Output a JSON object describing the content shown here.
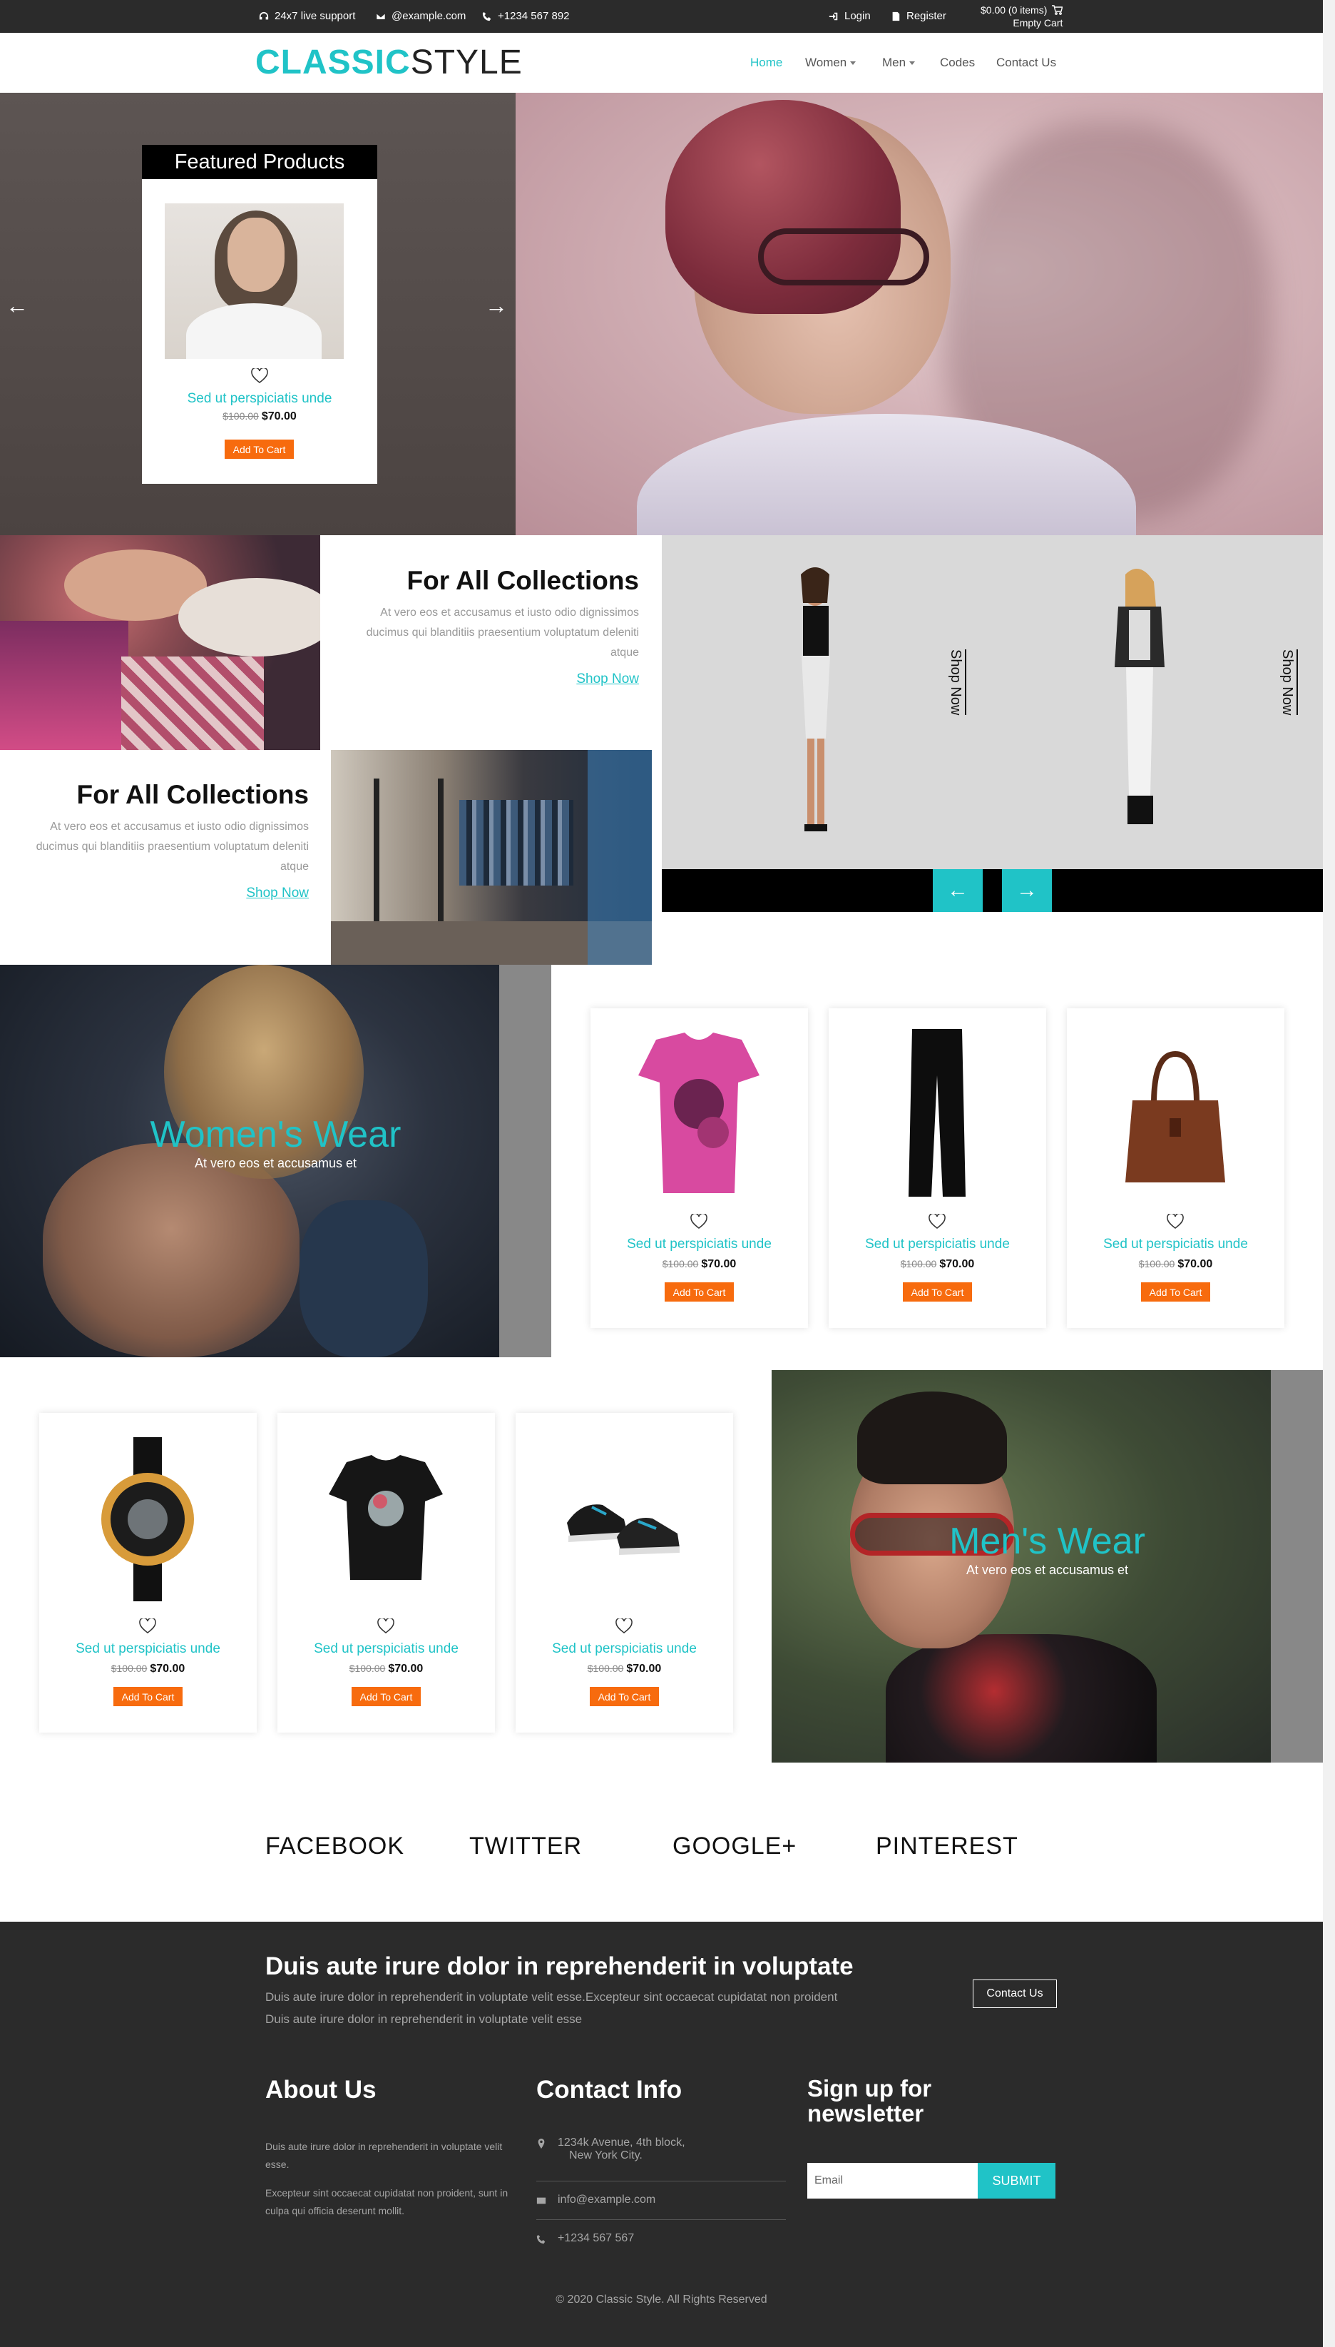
{
  "topbar": {
    "support": "24x7 live support",
    "email": "@example.com",
    "phone": "+1234 567 892",
    "login": "Login",
    "register": "Register",
    "cart_total": "$0.00 (0 items)",
    "cart_status": "Empty Cart"
  },
  "logo": {
    "part1": "CLASSIC",
    "part2": "STYLE"
  },
  "nav": {
    "home": "Home",
    "women": "Women",
    "men": "Men",
    "codes": "Codes",
    "contact": "Contact Us"
  },
  "featured": {
    "title": "Featured Products",
    "product": {
      "name": "Sed ut perspiciatis unde",
      "old_price": "$100.00",
      "price": "$70.00",
      "button": "Add To Cart"
    }
  },
  "collections": [
    {
      "title": "For All Collections",
      "text": "At vero eos et accusamus et iusto odio dignissimos ducimus qui blanditiis praesentium voluptatum deleniti atque",
      "link": "Shop Now"
    },
    {
      "title": "For All Collections",
      "text": "At vero eos et accusamus et iusto odio dignissimos ducimus qui blanditiis praesentium voluptatum deleniti atque",
      "link": "Shop Now"
    }
  ],
  "models": {
    "shop_now_1": "Shop Now",
    "shop_now_2": "Shop Now"
  },
  "women": {
    "title": "Women's Wear",
    "subtitle": "At vero eos et accusamus et"
  },
  "men": {
    "title": "Men's Wear",
    "subtitle": "At vero eos et accusamus et"
  },
  "products_women": [
    {
      "name": "Sed ut perspiciatis unde",
      "old_price": "$100.00",
      "price": "$70.00",
      "button": "Add To Cart",
      "icon": "tshirt-pink"
    },
    {
      "name": "Sed ut perspiciatis unde",
      "old_price": "$100.00",
      "price": "$70.00",
      "button": "Add To Cart",
      "icon": "pants-black"
    },
    {
      "name": "Sed ut perspiciatis unde",
      "old_price": "$100.00",
      "price": "$70.00",
      "button": "Add To Cart",
      "icon": "handbag-brown"
    }
  ],
  "products_men": [
    {
      "name": "Sed ut perspiciatis unde",
      "old_price": "$100.00",
      "price": "$70.00",
      "button": "Add To Cart",
      "icon": "watch"
    },
    {
      "name": "Sed ut perspiciatis unde",
      "old_price": "$100.00",
      "price": "$70.00",
      "button": "Add To Cart",
      "icon": "tshirt-black"
    },
    {
      "name": "Sed ut perspiciatis unde",
      "old_price": "$100.00",
      "price": "$70.00",
      "button": "Add To Cart",
      "icon": "sneakers"
    }
  ],
  "social": {
    "facebook": "FACEBOOK",
    "twitter": "TWITTER",
    "google": "GOOGLE+",
    "pinterest": "PINTEREST"
  },
  "footer": {
    "headline": "Duis aute irure dolor in reprehenderit in voluptate",
    "headline_text1": "Duis aute irure dolor in reprehenderit in voluptate velit esse.Excepteur sint occaecat cupidatat non proident",
    "headline_text2": "Duis aute irure dolor in reprehenderit in voluptate velit esse",
    "contact_button": "Contact Us",
    "about_title": "About Us",
    "about_text1": "Duis aute irure dolor in reprehenderit in voluptate velit esse.",
    "about_text2": "Excepteur sint occaecat cupidatat non proident, sunt in culpa qui officia deserunt mollit.",
    "contact_title": "Contact Info",
    "address_line1": "1234k Avenue, 4th block,",
    "address_line2": "New York City.",
    "email": "info@example.com",
    "phone": "+1234 567 567",
    "newsletter_title_1": "Sign up for",
    "newsletter_title_2": "newsletter",
    "email_placeholder": "Email",
    "submit": "SUBMIT",
    "copyright": "© 2020 Classic Style. All Rights Reserved"
  },
  "colors": {
    "accent": "#20c3c7",
    "cart_button": "#f76b0e",
    "dark": "#2b2b2b"
  }
}
